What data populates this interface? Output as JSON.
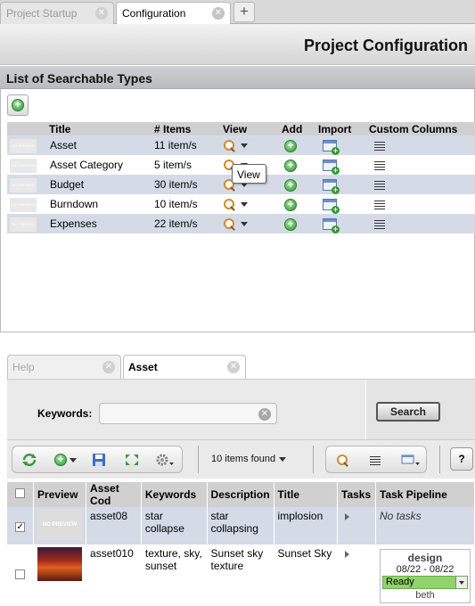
{
  "top_tabs": [
    {
      "label": "Project Startup",
      "active": false
    },
    {
      "label": "Configuration",
      "active": true
    }
  ],
  "page_title": "Project Configuration",
  "section_title": "List of Searchable Types",
  "types_table": {
    "headers": [
      "Title",
      "# Items",
      "View",
      "Add",
      "Import",
      "Custom Columns"
    ],
    "rows": [
      {
        "title": "Asset",
        "items": "11 item/s"
      },
      {
        "title": "Asset Category",
        "items": "5 item/s"
      },
      {
        "title": "Budget",
        "items": "30 item/s"
      },
      {
        "title": "Burndown",
        "items": "10 item/s"
      },
      {
        "title": "Expenses",
        "items": "22 item/s"
      }
    ],
    "preview_text": "NO PREVIEW"
  },
  "tooltip": "View",
  "lower_tabs": [
    {
      "label": "Help",
      "active": false
    },
    {
      "label": "Asset",
      "active": true
    }
  ],
  "search": {
    "keywords_label": "Keywords:",
    "keywords_value": "",
    "button_label": "Search"
  },
  "toolbar": {
    "items_found": "10 items found",
    "help_label": "?"
  },
  "results": {
    "headers": [
      "Preview",
      "Asset Cod",
      "Keywords",
      "Description",
      "Title",
      "Tasks",
      "Task Pipeline"
    ],
    "rows": [
      {
        "checked": true,
        "preview": "NO PREVIEW",
        "code": "asset08",
        "keywords": "star collapse",
        "description": "star collapsing",
        "title": "implosion",
        "pipeline_text": "No tasks"
      },
      {
        "checked": false,
        "preview": "",
        "code": "asset010",
        "keywords": "texture, sky, sunset",
        "description": "Sunset sky texture",
        "title": "Sunset Sky",
        "pipeline": {
          "process": "design",
          "dates": "08/22 - 08/22",
          "status": "Ready",
          "user": "beth"
        }
      }
    ]
  },
  "colors": {
    "row_alt": "#d5dbe6",
    "status_ready": "#8fd46a",
    "header_gray": "#d0d0d0"
  }
}
